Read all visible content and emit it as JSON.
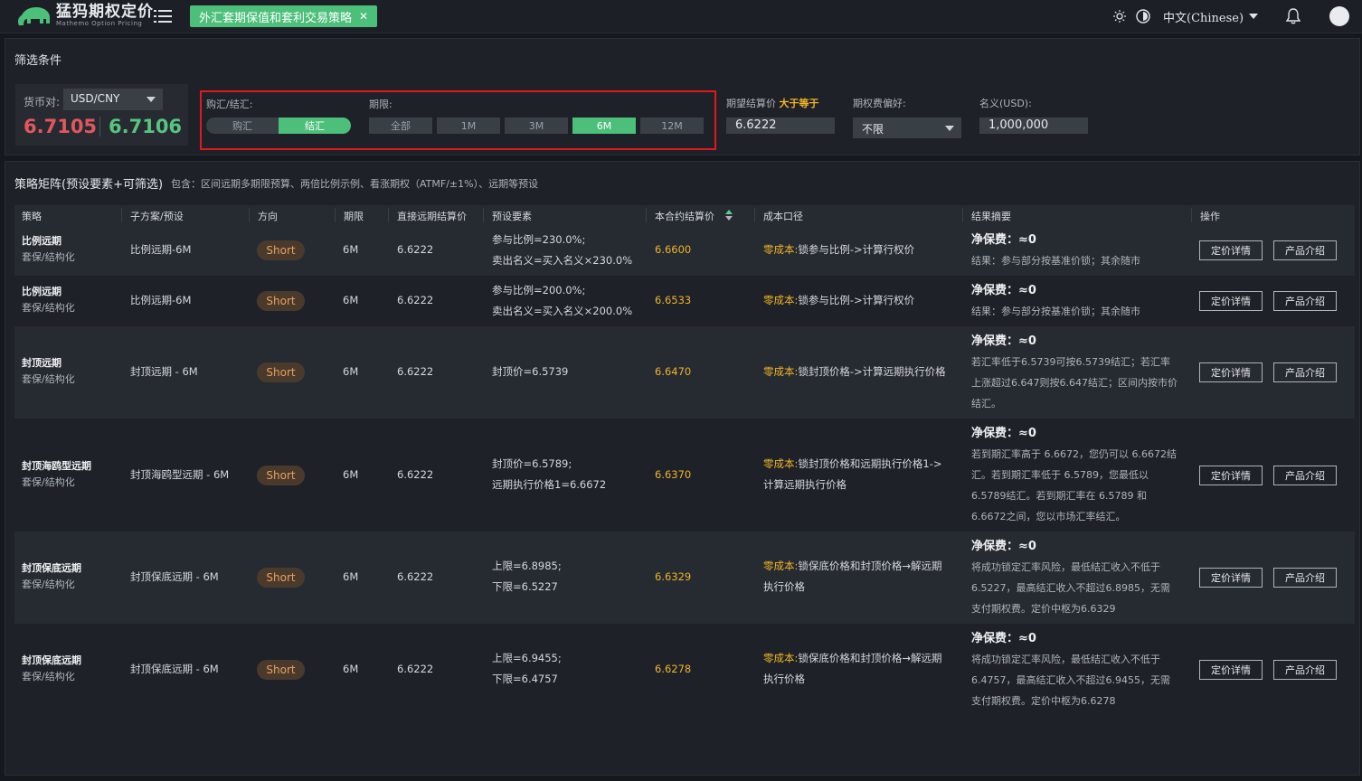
{
  "app": {
    "title": "猛犸期权定价",
    "subtitle": "Mathemo Option Pricing",
    "active_tab": "外汇套期保值和套利交易策略",
    "language": "中文(Chinese)"
  },
  "filters": {
    "section_title": "筛选条件",
    "currency_pair_label": "货币对:",
    "currency_pair_value": "USD/CNY",
    "bid": "6.7105",
    "ask": "6.7106",
    "direction_label": "购汇/结汇:",
    "direction_options": [
      "购汇",
      "结汇"
    ],
    "direction_selected": "结汇",
    "tenor_label": "期限:",
    "tenor_options": [
      "全部",
      "1M",
      "3M",
      "6M",
      "12M"
    ],
    "tenor_selected": "6M",
    "expected_price_label": "期望结算价",
    "expected_price_cond": "大于等于",
    "expected_price_value": "6.6222",
    "premium_pref_label": "期权费偏好:",
    "premium_pref_value": "不限",
    "notional_label": "名义(USD):",
    "notional_value": "1,000,000"
  },
  "matrix": {
    "title": "策略矩阵(预设要素+可筛选)",
    "description": "包含：区间远期多期限预算、两倍比例示例、看涨期权（ATMF/±1%）、远期等预设",
    "columns": [
      "策略",
      "子方案/预设",
      "方向",
      "期限",
      "直接远期结算价",
      "预设要素",
      "本合约结算价",
      "成本口径",
      "结果摘要",
      "操作"
    ],
    "buttons": {
      "pricing": "定价详情",
      "product": "产品介绍"
    },
    "rows": [
      {
        "strategy": "比例远期",
        "category": "套保/结构化",
        "sub": "比例远期-6M",
        "direction": "Short",
        "tenor": "6M",
        "forward": "6.6222",
        "params": [
          "参与比例=230.0%;",
          "卖出名义=买入名义×230.0%"
        ],
        "price": "6.6600",
        "cost_key": "零成本:",
        "cost_text": [
          "锁参与比例->计算行权价"
        ],
        "fee": "净保费：≈0",
        "result": [
          "结果：参与部分按基准价锁；其余随市"
        ]
      },
      {
        "strategy": "比例远期",
        "category": "套保/结构化",
        "sub": "比例远期-6M",
        "direction": "Short",
        "tenor": "6M",
        "forward": "6.6222",
        "params": [
          "参与比例=200.0%;",
          "卖出名义=买入名义×200.0%"
        ],
        "price": "6.6533",
        "cost_key": "零成本:",
        "cost_text": [
          "锁参与比例->计算行权价"
        ],
        "fee": "净保费：≈0",
        "result": [
          "结果：参与部分按基准价锁；其余随市"
        ]
      },
      {
        "strategy": "封顶远期",
        "category": "套保/结构化",
        "sub": "封顶远期 - 6M",
        "direction": "Short",
        "tenor": "6M",
        "forward": "6.6222",
        "params": [
          "封顶价=6.5739"
        ],
        "price": "6.6470",
        "cost_key": "零成本:",
        "cost_text": [
          "锁封顶价格->计算远期执行价格"
        ],
        "fee": "净保费：≈0",
        "result": [
          "若汇率低于6.5739可按6.5739结汇；若汇率",
          "上涨超过6.647则按6.647结汇；区间内按市价",
          "结汇。"
        ]
      },
      {
        "strategy": "封顶海鸥型远期",
        "category": "套保/结构化",
        "sub": "封顶海鸥型远期 - 6M",
        "direction": "Short",
        "tenor": "6M",
        "forward": "6.6222",
        "params": [
          "封顶价=6.5789;",
          "远期执行价格1=6.6672"
        ],
        "price": "6.6370",
        "cost_key": "零成本:",
        "cost_text": [
          "锁封顶价格和远期执行价格1->",
          "计算远期执行价格"
        ],
        "fee": "净保费：≈0",
        "result": [
          "若到期汇率高于 6.6672，您仍可以 6.6672结",
          "汇。若到期汇率低于 6.5789，您最低以",
          "6.5789结汇。若到期汇率在 6.5789 和",
          "6.6672之间，您以市场汇率结汇。"
        ]
      },
      {
        "strategy": "封顶保底远期",
        "category": "套保/结构化",
        "sub": "封顶保底远期 - 6M",
        "direction": "Short",
        "tenor": "6M",
        "forward": "6.6222",
        "params": [
          "上限=6.8985;",
          "下限=6.5227"
        ],
        "price": "6.6329",
        "cost_key": "零成本:",
        "cost_text": [
          "锁保底价格和封顶价格→解远期",
          "执行价格"
        ],
        "fee": "净保费：≈0",
        "result": [
          "将成功锁定汇率风险，最低结汇收入不低于",
          "6.5227，最高结汇收入不超过6.8985，无需",
          "支付期权费。定价中枢为6.6329"
        ]
      },
      {
        "strategy": "封顶保底远期",
        "category": "套保/结构化",
        "sub": "封顶保底远期 - 6M",
        "direction": "Short",
        "tenor": "6M",
        "forward": "6.6222",
        "params": [
          "上限=6.9455;",
          "下限=6.4757"
        ],
        "price": "6.6278",
        "cost_key": "零成本:",
        "cost_text": [
          "锁保底价格和封顶价格→解远期",
          "执行价格"
        ],
        "fee": "净保费：≈0",
        "result": [
          "将成功锁定汇率风险，最低结汇收入不低于",
          "6.4757，最高结汇收入不超过6.9455，无需",
          "支付期权费。定价中枢为6.6278"
        ]
      }
    ]
  }
}
